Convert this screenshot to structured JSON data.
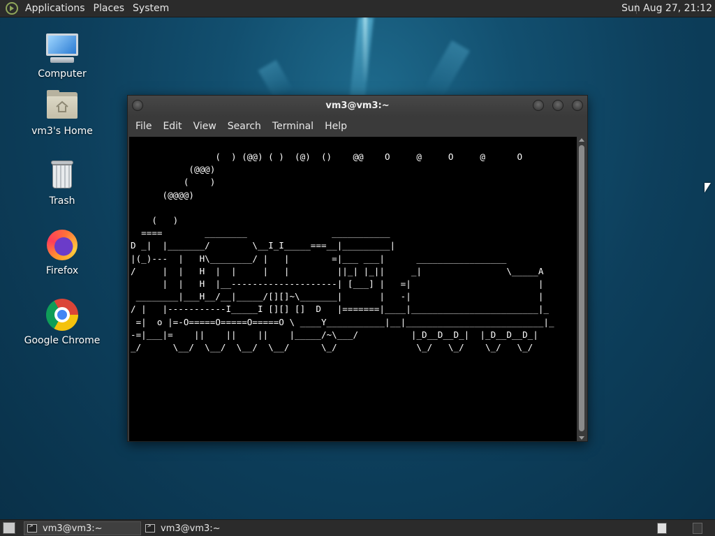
{
  "top_panel": {
    "menus": [
      "Applications",
      "Places",
      "System"
    ],
    "clock": "Sun Aug 27, 21:12"
  },
  "desktop_icons": [
    {
      "label": "Computer",
      "icon": "computer-icon"
    },
    {
      "label": "vm3's Home",
      "icon": "home-folder-icon"
    },
    {
      "label": "Trash",
      "icon": "trash-icon"
    },
    {
      "label": "Firefox",
      "icon": "firefox-icon"
    },
    {
      "label": "Google Chrome",
      "icon": "chrome-icon"
    }
  ],
  "terminal": {
    "title": "vm3@vm3:~",
    "menu": [
      "File",
      "Edit",
      "View",
      "Search",
      "Terminal",
      "Help"
    ],
    "output": "                (  ) (@@) ( )  (@)  ()    @@    O     @     O     @      O\n           (@@@)\n          (    )\n      (@@@@)\n\n    (   )\n  ====        ________                ___________\nD _|  |_______/        \\__I_I_____===__|_________|\n|(_)---  |   H\\________/ |   |        =|___ ___|      _________________\n/     |  |   H  |  |     |   |         ||_| |_||     _|                \\_____A\n      |  |   H  |__--------------------| [___] |   =|                        |\n ________|___H__/__|_____/[][]~\\_______|       |   -|                        |\n/ |   |-----------I_____I [][] []  D   |=======|____|________________________|_\n =|  o |=-O=====O=====O=====O \\ ____Y___________|__|__________________________|_\n-=|___|=    ||    ||    ||    |_____/~\\___/          |_D__D__D_|  |_D__D__D_|\n_/      \\__/  \\__/  \\__/  \\__/      \\_/               \\_/   \\_/    \\_/   \\_/"
  },
  "taskbar": {
    "tasks": [
      {
        "label": "vm3@vm3:~",
        "active": true
      },
      {
        "label": "vm3@vm3:~",
        "active": false
      }
    ]
  }
}
